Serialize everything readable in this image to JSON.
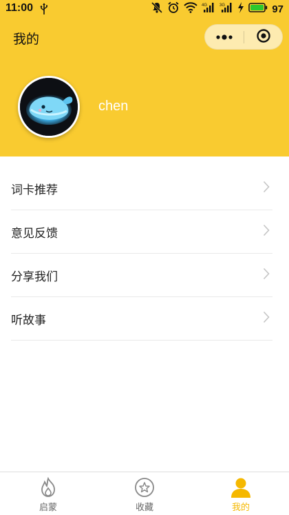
{
  "status_bar": {
    "time": "11:00",
    "battery_percent": "97"
  },
  "nav": {
    "title": "我的"
  },
  "profile": {
    "username": "chen"
  },
  "menu": {
    "items": [
      {
        "label": "词卡推荐"
      },
      {
        "label": "意见反馈"
      },
      {
        "label": "分享我们"
      },
      {
        "label": "听故事"
      }
    ]
  },
  "tabbar": {
    "tabs": [
      {
        "label": "启蒙",
        "icon": "flame-icon",
        "active": false
      },
      {
        "label": "收藏",
        "icon": "star-circle-icon",
        "active": false
      },
      {
        "label": "我的",
        "icon": "user-icon",
        "active": true
      }
    ]
  },
  "colors": {
    "header_bg": "#f9cb30",
    "active_tab": "#f5b800",
    "battery": "#2dc82d"
  }
}
